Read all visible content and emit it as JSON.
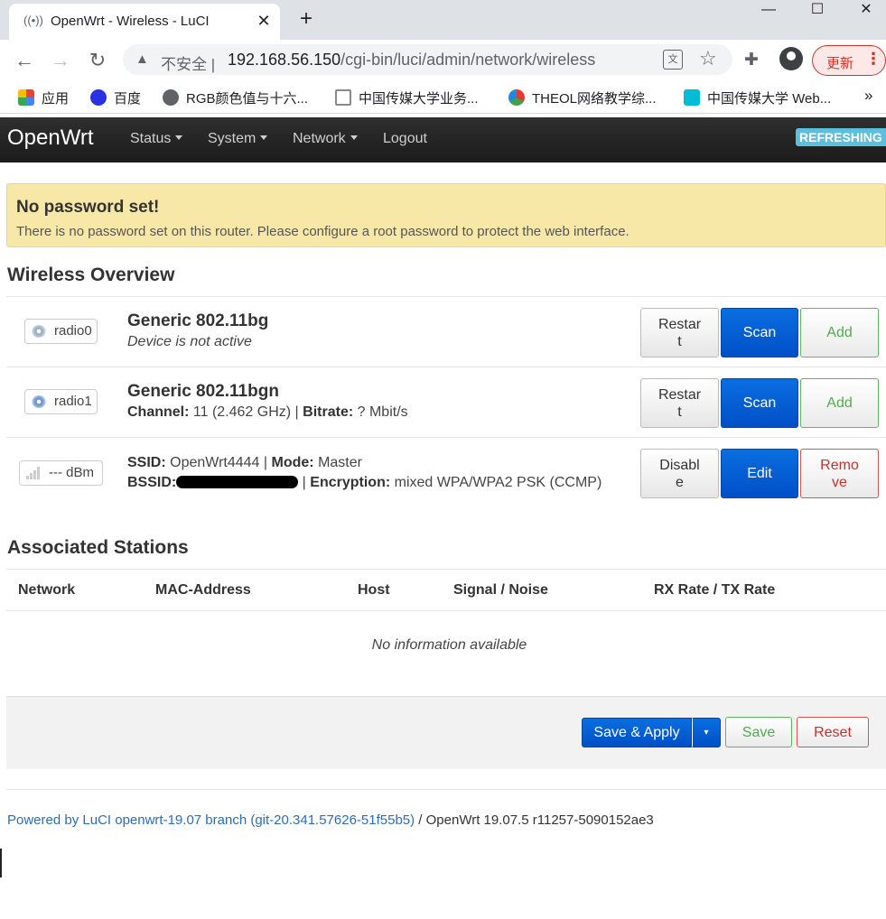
{
  "browser": {
    "tab_title": "OpenWrt - Wireless - LuCI",
    "new_tab": "+",
    "tab_close": "✕",
    "insecure_label": "不安全",
    "url_host": "192.168.56.150",
    "url_path": "/cgi-bin/luci/admin/network/wireless",
    "update_label": "更新",
    "bookmarks": [
      {
        "label": "应用",
        "icon": "apps-grid-icon"
      },
      {
        "label": "百度",
        "icon": "baidu-paw-icon"
      },
      {
        "label": "RGB颜色值与十六...",
        "icon": "globe-icon"
      },
      {
        "label": "中国传媒大学业务...",
        "icon": "home-icon"
      },
      {
        "label": "THEOL网络教学综...",
        "icon": "theol-logo-icon"
      },
      {
        "label": "中国传媒大学 Web...",
        "icon": "lock-icon"
      }
    ],
    "bookmarks_more": "»"
  },
  "header": {
    "brand": "OpenWrt",
    "menu": [
      "Status",
      "System",
      "Network",
      "Logout"
    ],
    "refreshing": "REFRESHING"
  },
  "alert": {
    "title": "No password set!",
    "text": "There is no password set on this router. Please configure a root password to protect the web interface."
  },
  "wireless": {
    "heading": "Wireless Overview",
    "radios": [
      {
        "badge": "radio0",
        "title": "Generic 802.11bg",
        "status": "Device is not active",
        "buttons": {
          "restart": [
            "Restar",
            "t"
          ],
          "scan": "Scan",
          "add": "Add"
        }
      },
      {
        "badge": "radio1",
        "title": "Generic 802.11bgn",
        "channel_label": "Channel:",
        "channel": "11 (2.462 GHz)",
        "bitrate_label": "Bitrate:",
        "bitrate": "? Mbit/s",
        "buttons": {
          "restart": [
            "Restar",
            "t"
          ],
          "scan": "Scan",
          "add": "Add"
        }
      }
    ],
    "network": {
      "badge": "--- dBm",
      "ssid_label": "SSID:",
      "ssid": "OpenWrt4444",
      "mode_label": "Mode:",
      "mode": "Master",
      "bssid_label": "BSSID:",
      "encryption_label": "Encryption:",
      "encryption": "mixed WPA/WPA2 PSK (CCMP)",
      "buttons": {
        "disable": [
          "Disabl",
          "e"
        ],
        "edit": "Edit",
        "remove": [
          "Remo",
          "ve"
        ]
      }
    }
  },
  "stations": {
    "heading": "Associated Stations",
    "columns": [
      "Network",
      "MAC-Address",
      "Host",
      "Signal / Noise",
      "RX Rate / TX Rate"
    ],
    "empty": "No information available"
  },
  "actions": {
    "save_apply": "Save & Apply",
    "save": "Save",
    "reset": "Reset"
  },
  "footer": {
    "link": "Powered by LuCI openwrt-19.07 branch (git-20.341.57626-51f55b5)",
    "text": " / OpenWrt 19.07.5 r11257-5090152ae3"
  },
  "colors": {
    "primary": "#0050c6",
    "success": "#4cae4c",
    "danger": "#c9302c",
    "alert_bg": "#f8e8a8",
    "refreshing": "#5bc0de"
  }
}
